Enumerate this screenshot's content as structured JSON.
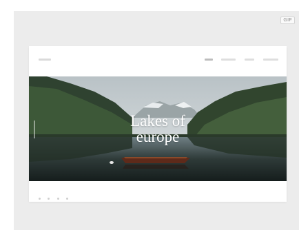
{
  "badge": {
    "label": "GIF"
  },
  "hero": {
    "title_line1": "Lakes of",
    "title_line2": "europe"
  }
}
